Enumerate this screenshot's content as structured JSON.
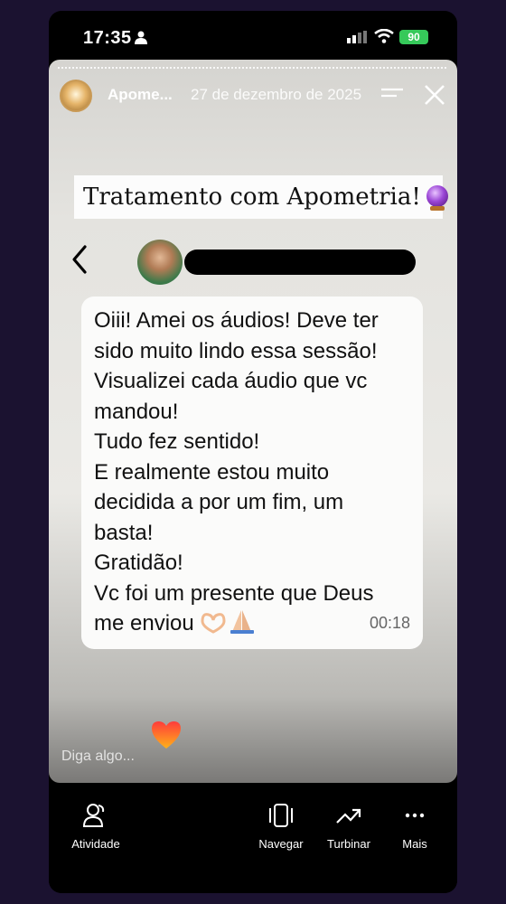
{
  "status_bar": {
    "time": "17:35",
    "battery": "90"
  },
  "story": {
    "account_name": "Apome...",
    "date": "27 de dezembro de 2025",
    "caption": "Tratamento com Apometria!",
    "caption_emoji": "crystal-ball",
    "chat": {
      "message_lines": [
        "Oiii! Amei os áudios! Deve ter",
        "sido muito lindo essa sessão!",
        "Visualizei cada áudio que vc",
        "mandou!",
        "Tudo fez sentido!",
        "E realmente estou muito",
        "decidida a por um fim, um",
        "basta!",
        "Gratidão!",
        "Vc foi um presente que Deus",
        "me enviou"
      ],
      "timestamp": "00:18"
    },
    "reply_placeholder": "Diga algo..."
  },
  "bottom_bar": {
    "activity": "Atividade",
    "navigate": "Navegar",
    "boost": "Turbinar",
    "more": "Mais"
  },
  "colors": {
    "background": "#1b1230",
    "battery": "#36c95a",
    "heart": "#ff5a2a"
  }
}
